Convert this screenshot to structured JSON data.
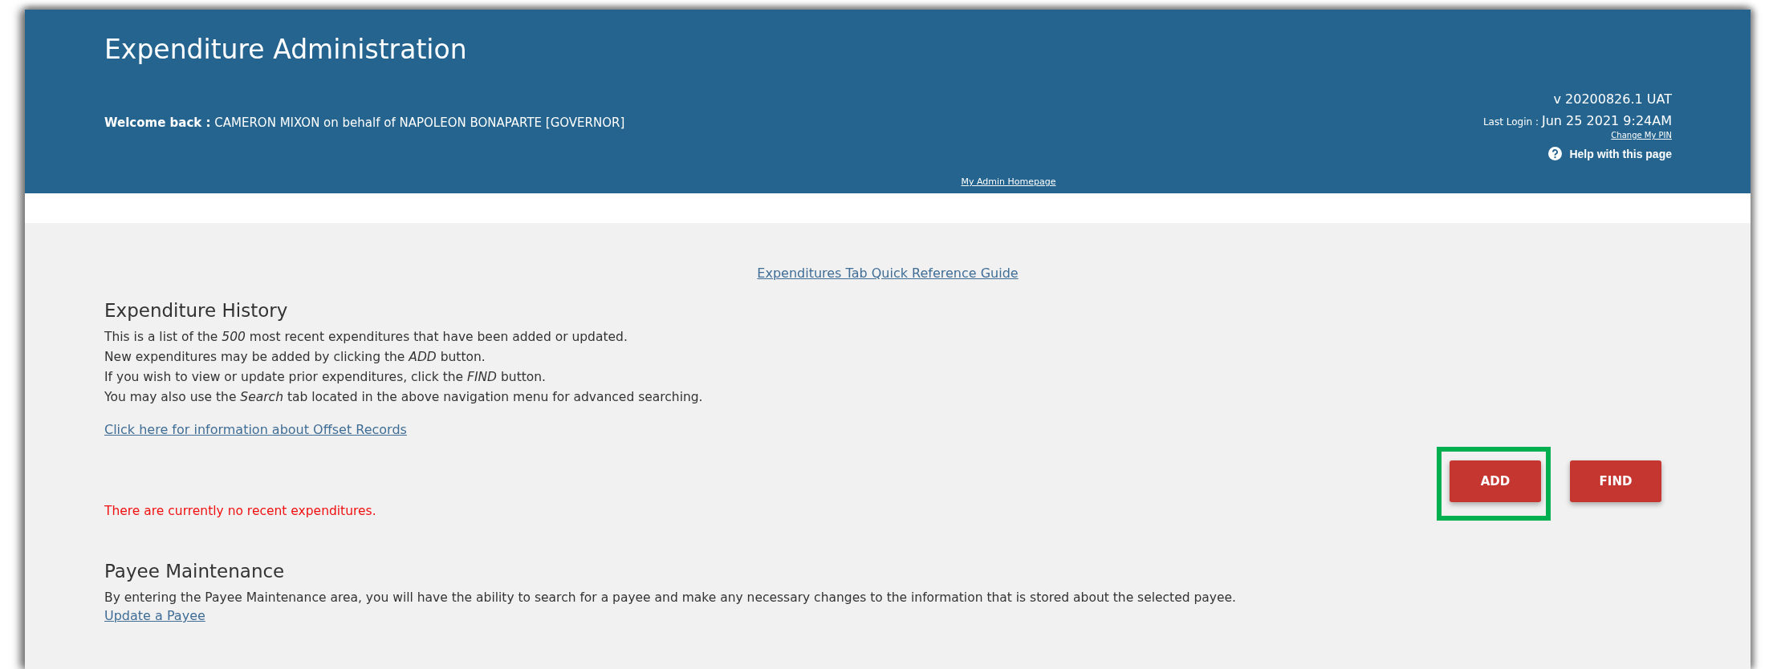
{
  "header": {
    "title": "Expenditure Administration",
    "welcome_label": "Welcome back :",
    "welcome_text": "CAMERON MIXON on behalf of NAPOLEON BONAPARTE [GOVERNOR]",
    "version": "v 20200826.1 UAT",
    "last_login_label": "Last Login :",
    "last_login_value": "Jun 25 2021 9:24AM",
    "change_pin_link": "Change My PIN",
    "help_link": "Help with this page",
    "home_link": "My Admin Homepage"
  },
  "guide_link": "Expenditures Tab Quick Reference Guide",
  "history": {
    "heading": "Expenditure History",
    "lines": [
      "This is a list of the *500* most recent expenditures that have been added or updated.",
      "New expenditures may be added by clicking the *ADD* button.",
      "If you wish to view or update prior expenditures, click the *FIND* button.",
      "You may also use the *Search* tab located in the above navigation menu for advanced searching."
    ],
    "offset_link": "Click here for information about Offset Records",
    "buttons": [
      {
        "label": "ADD",
        "highlighted": true
      },
      {
        "label": "FIND",
        "highlighted": false
      }
    ],
    "empty_message": "There are currently no recent expenditures."
  },
  "payee": {
    "heading": "Payee Maintenance",
    "text": "By entering the Payee Maintenance area, you will have the ability to search for a payee and make any necessary changes to the information that is stored about the selected payee.",
    "link": "Update a Payee"
  }
}
